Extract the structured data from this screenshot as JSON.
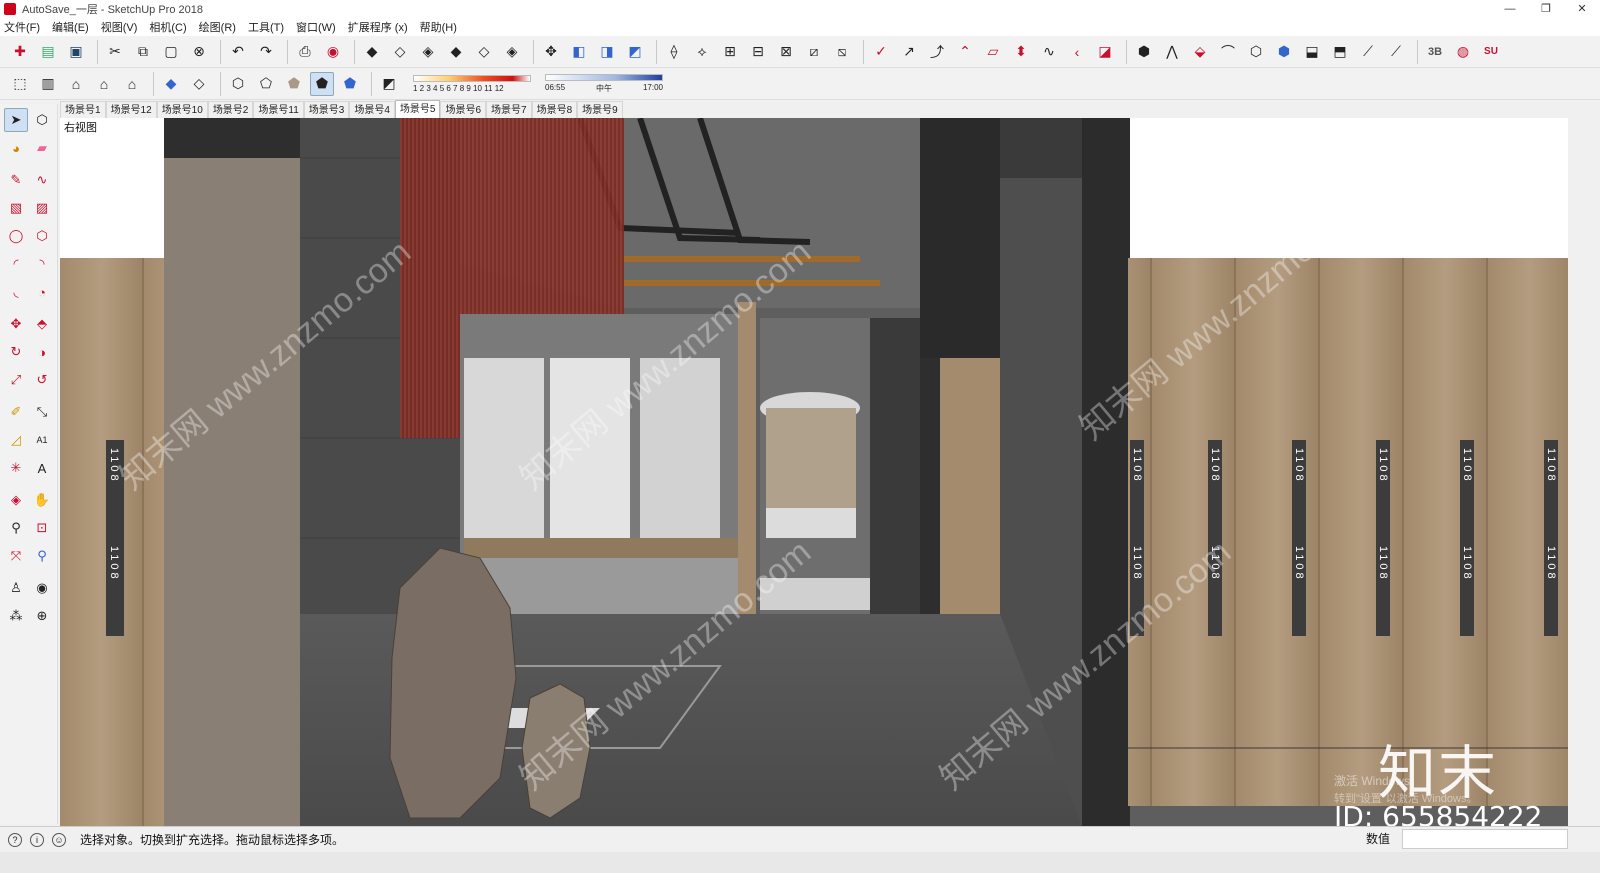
{
  "window": {
    "title": "AutoSave_一层 - SketchUp Pro 2018",
    "controls": [
      "—",
      "❐",
      "✕"
    ]
  },
  "menu": [
    "文件(F)",
    "编辑(E)",
    "视图(V)",
    "相机(C)",
    "绘图(R)",
    "工具(T)",
    "窗口(W)",
    "扩展程序 (x)",
    "帮助(H)"
  ],
  "shadow_settings": {
    "month_ticks": "1  2  3  4  5  6  7  8  9  10 11 12",
    "time_start": "06:55",
    "time_mid": "中午",
    "time_end": "17:00"
  },
  "scene_tabs": [
    "场景号1",
    "场景号12",
    "场景号10",
    "场景号2",
    "场景号11",
    "场景号3",
    "场景号4",
    "场景号5",
    "场景号6",
    "场景号7",
    "场景号8",
    "场景号9"
  ],
  "active_tab_index": 7,
  "viewport": {
    "corner_label": "右视图",
    "room_numbers": [
      "1108",
      "1108",
      "1108",
      "1108",
      "1108",
      "1108",
      "1108",
      "1108",
      "1108",
      "1108",
      "1108",
      "1108",
      "1108",
      "1108"
    ],
    "watermark_text": "知末网 www.znzmo.com"
  },
  "overlay": {
    "brand": "知末",
    "id_text": "ID: 655854222",
    "activate_line1": "激活 Windows",
    "activate_line2": "转到\"设置\"以激活 Windows。"
  },
  "status": {
    "message": "选择对象。切换到扩充选择。拖动鼠标选择多项。",
    "measurements_label": "数值"
  },
  "colors": {
    "accent_red": "#c8102e",
    "curtain": "#7a2a22",
    "wood": "#a58b6e",
    "floor": "#5a5a5a"
  }
}
